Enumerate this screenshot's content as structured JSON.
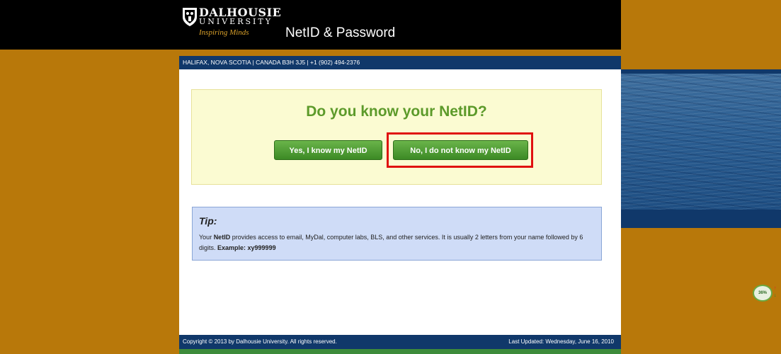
{
  "header": {
    "logo_line1": "DALHOUSIE",
    "logo_line2": "UNIVERSITY",
    "logo_tagline": "Inspiring Minds",
    "app_title": "NetID & Password"
  },
  "address_bar": "HALIFAX, NOVA SCOTIA | CANADA B3H 3J5 | +1 (902) 494-2376",
  "question": {
    "title": "Do you know your NetID?",
    "yes_label": "Yes, I know my NetID",
    "no_label": "No, I do not know my NetID"
  },
  "tip": {
    "title": "Tip:",
    "text_before": "Your ",
    "netid_bold": "NetID",
    "text_middle": " provides access to email, MyDal, computer labs, BLS, and other services. It is usually 2 letters from your name followed by 6 digits. ",
    "example": "Example: xy999999"
  },
  "footer": {
    "copyright": "Copyright © 2013 by Dalhousie University. All rights reserved.",
    "last_updated": "Last Updated: Wednesday, June 16, 2010"
  },
  "widget": {
    "percent": "36%",
    "up_glyph": "↑",
    "down_glyph": "↓"
  },
  "colors": {
    "page_background": "#b8780a",
    "header_background": "#000000",
    "bar_navy": "#10386a",
    "question_green": "#5c9a2a",
    "button_green": "#3c8a25",
    "highlight_red": "#e01010",
    "tip_background": "#cfdcf7"
  },
  "icons": [
    "dalhousie-crest-icon",
    "water-image"
  ]
}
